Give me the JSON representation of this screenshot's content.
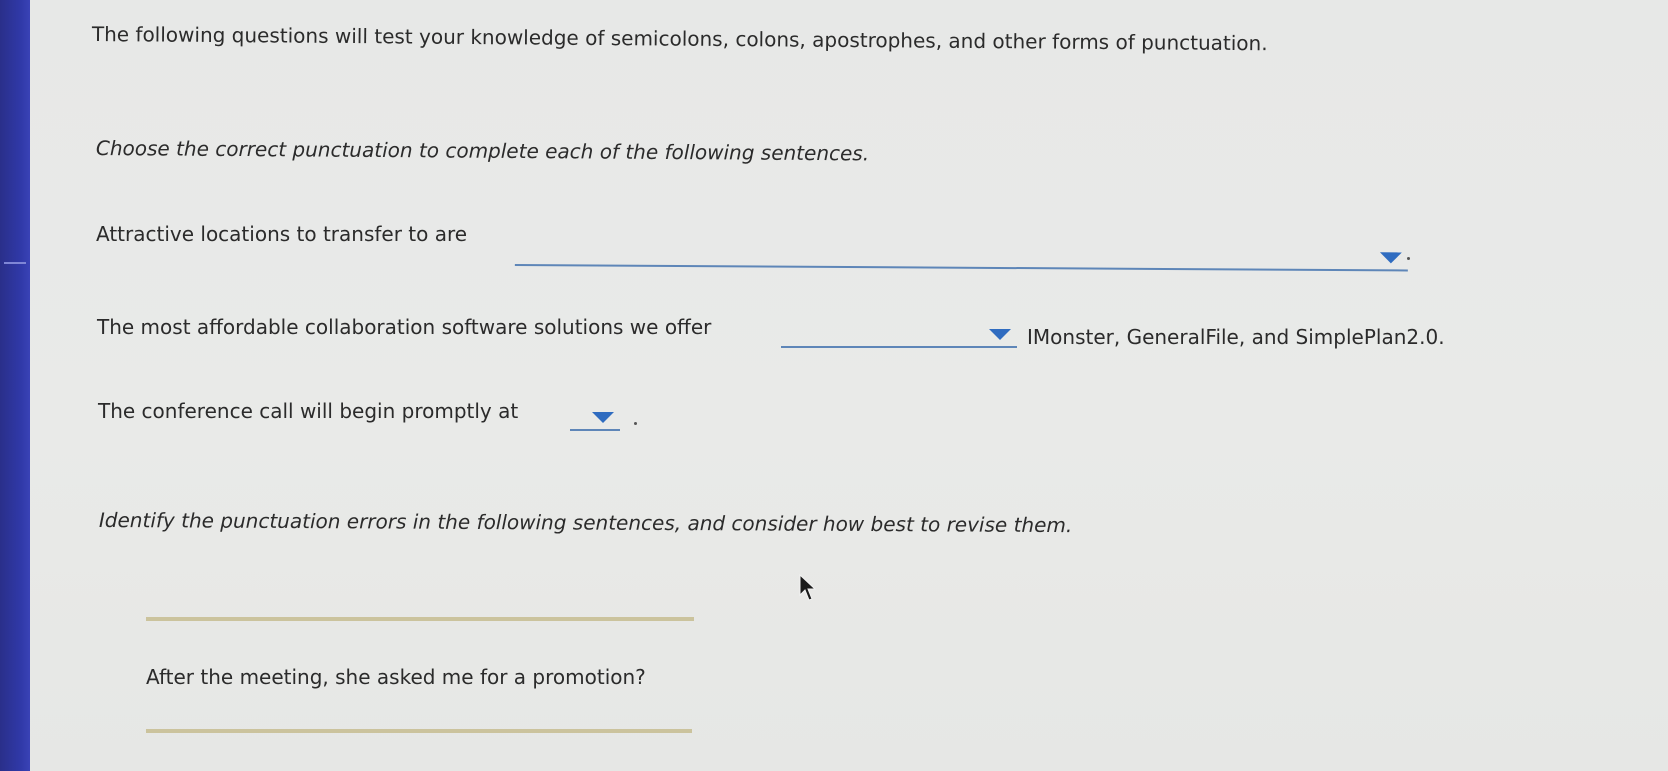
{
  "intro_text": "The following questions will test your knowledge of semicolons, colons, apostrophes, and other forms of punctuation.",
  "section1": {
    "instruction": "Choose the correct punctuation to complete each of the following sentences.",
    "questions": [
      {
        "before": "Attractive locations to transfer to are",
        "after": "."
      },
      {
        "before": "The most affordable collaboration software solutions we offer",
        "after": "IMonster, GeneralFile, and SimplePlan2.0."
      },
      {
        "before": "The conference call will begin promptly at",
        "after": "."
      }
    ]
  },
  "section2": {
    "instruction": "Identify the punctuation errors in the following sentences, and consider how best to revise them.",
    "sentence": "After the meeting, she asked me for a promotion?"
  },
  "colors": {
    "accent": "#2f6cc0",
    "sidebar": "#2a2f8a",
    "answer_line": "#cbc39d"
  },
  "icons": {
    "dropdown": "caret-down-icon",
    "cursor": "mouse-pointer-icon"
  }
}
